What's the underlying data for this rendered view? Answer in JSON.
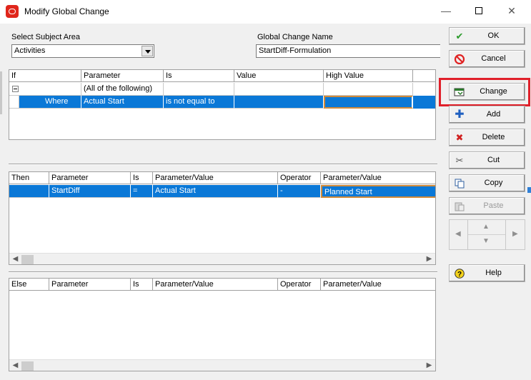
{
  "window": {
    "title": "Modify Global Change"
  },
  "titlebar_controls": {
    "minimize": "—",
    "close": "✕"
  },
  "subject_area": {
    "label": "Select Subject Area",
    "value": "Activities"
  },
  "change_name": {
    "label": "Global Change Name",
    "value": "StartDiff-Formulation"
  },
  "if_grid": {
    "headers": [
      "If",
      "Parameter",
      "Is",
      "Value",
      "High Value"
    ],
    "group_label": "(All of the following)",
    "row": {
      "if": "Where",
      "parameter": "Actual Start",
      "is": "is not equal to",
      "value": "",
      "high_value": ""
    }
  },
  "then_grid": {
    "headers": [
      "Then",
      "Parameter",
      "Is",
      "Parameter/Value",
      "Operator",
      "Parameter/Value"
    ],
    "row": {
      "then": "",
      "parameter": "StartDiff",
      "is": "=",
      "value1": "Actual Start",
      "operator": "-",
      "value2": "Planned Start"
    }
  },
  "else_grid": {
    "headers": [
      "Else",
      "Parameter",
      "Is",
      "Parameter/Value",
      "Operator",
      "Parameter/Value"
    ]
  },
  "buttons": {
    "ok": "OK",
    "cancel": "Cancel",
    "change": "Change",
    "add": "Add",
    "delete": "Delete",
    "cut": "Cut",
    "copy": "Copy",
    "paste": "Paste",
    "help": "Help"
  },
  "icons": {
    "ok": "check-icon",
    "cancel": "no-entry-icon",
    "change": "change-icon",
    "add": "plus-icon",
    "delete": "x-icon",
    "cut": "scissors-icon",
    "copy": "copy-icon",
    "paste": "paste-icon",
    "help": "question-icon"
  },
  "colors": {
    "selection": "#0a78d7",
    "highlight": "#e0202a",
    "ok_check": "#2a9a2a",
    "cancel_red": "#e02020"
  }
}
